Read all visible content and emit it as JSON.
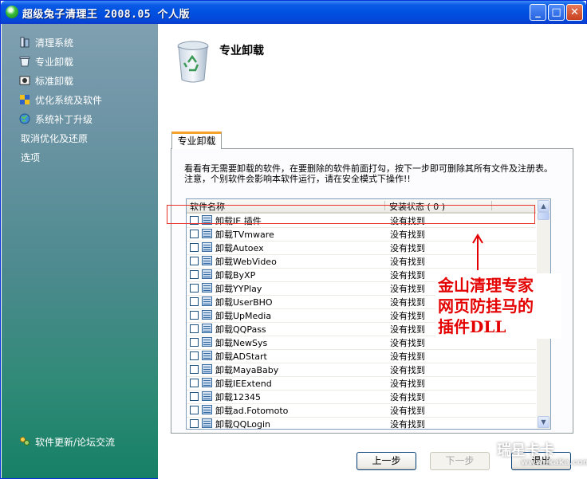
{
  "window": {
    "title": "超级兔子清理王 2008.05 个人版"
  },
  "title_buttons": {
    "minimize": "_",
    "maximize": "□",
    "close": "✕"
  },
  "sidebar": {
    "items": [
      {
        "label": "清理系统",
        "icon": "broom-icon"
      },
      {
        "label": "专业卸载",
        "icon": "recycle-bin-icon"
      },
      {
        "label": "标准卸载",
        "icon": "uninstall-icon"
      },
      {
        "label": "优化系统及软件",
        "icon": "optimize-icon"
      },
      {
        "label": "系统补丁升级",
        "icon": "globe-icon"
      },
      {
        "label": "取消优化及还原",
        "icon": ""
      },
      {
        "label": "选项",
        "icon": ""
      }
    ],
    "footer": "软件更新/论坛交流"
  },
  "main": {
    "title": "专业卸载",
    "tab": "专业卸载",
    "description": "看看有无需要卸载的软件，在要删除的软件前面打勾，按下一步即可删除其所有文件及注册表。注意，个别软件会影响本软件运行，请在安全模式下操作!!",
    "columns": {
      "name": "软件名称",
      "status": "安装状态 ( 0 )"
    },
    "rows": [
      {
        "name": "卸载IE 插件",
        "status": "没有找到"
      },
      {
        "name": "卸载TVmware",
        "status": "没有找到"
      },
      {
        "name": "卸载Autoex",
        "status": "没有找到"
      },
      {
        "name": "卸载WebVideo",
        "status": "没有找到"
      },
      {
        "name": "卸载ByXP",
        "status": "没有找到"
      },
      {
        "name": "卸载YYPlay",
        "status": "没有找到"
      },
      {
        "name": "卸载UserBHO",
        "status": "没有找到"
      },
      {
        "name": "卸载UpMedia",
        "status": "没有找到"
      },
      {
        "name": "卸载QQPass",
        "status": "没有找到"
      },
      {
        "name": "卸载NewSys",
        "status": "没有找到"
      },
      {
        "name": "卸载ADStart",
        "status": "没有找到"
      },
      {
        "name": "卸载MayaBaby",
        "status": "没有找到"
      },
      {
        "name": "卸载IEExtend",
        "status": "没有找到"
      },
      {
        "name": "卸载12345",
        "status": "没有找到"
      },
      {
        "name": "卸载ad.Fotomoto",
        "status": "没有找到"
      },
      {
        "name": "卸载QQLogin",
        "status": "没有找到"
      }
    ]
  },
  "annotation": {
    "line1": "金山清理专家",
    "line2": "网页防挂马的",
    "line3": "插件DLL"
  },
  "buttons": {
    "prev": "上一步",
    "next": "下一步",
    "exit": "退出"
  },
  "watermark": {
    "text": "瑞星卡卡",
    "url": "www.ikaka.com"
  }
}
